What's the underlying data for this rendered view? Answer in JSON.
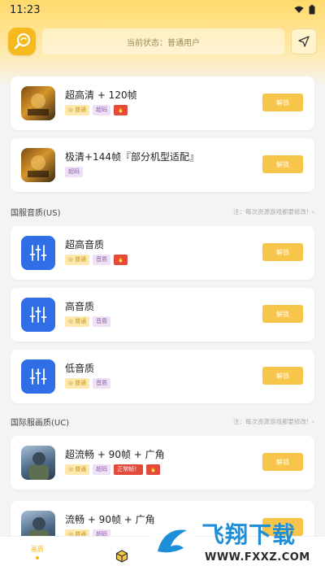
{
  "status_bar": {
    "time": "11:23"
  },
  "header": {
    "status_text": "当前状态：普通用户"
  },
  "colors": {
    "accent": "#f6c54a",
    "brand": "#f6b91e",
    "audio_icon": "#2f6ee6",
    "hot_tag": "#e24b3b"
  },
  "unlock_label": "解锁",
  "cards_top": [
    {
      "title": "超高清 + 120帧",
      "icon": "game-icon",
      "tags": [
        "普通",
        "超码",
        "hot"
      ]
    },
    {
      "title": "极清+144帧『部分机型适配』",
      "icon": "game-icon",
      "tags": [
        "超码"
      ]
    }
  ],
  "section_us": {
    "title": "国服音质(US)",
    "note": "注：每次资源游戏都要修改!"
  },
  "cards_us": [
    {
      "title": "超高音质",
      "icon": "equalizer-icon",
      "tags": [
        "普通",
        "音质",
        "hot"
      ]
    },
    {
      "title": "高音质",
      "icon": "equalizer-icon",
      "tags": [
        "普通",
        "音质"
      ]
    },
    {
      "title": "低音质",
      "icon": "equalizer-icon",
      "tags": [
        "普通",
        "音质"
      ]
    }
  ],
  "section_uc": {
    "title": "国际服画质(UC)",
    "note": "注：每次资源游戏都要修改!"
  },
  "cards_uc": [
    {
      "title": "超流畅 + 90帧 + 广角",
      "icon": "pubg-icon",
      "tags": [
        "普通",
        "超码",
        "正常帧！",
        "hot"
      ]
    },
    {
      "title": "流畅 + 90帧 + 广角",
      "icon": "pubg-icon",
      "tags": [
        "普通",
        "超码"
      ]
    }
  ],
  "bottom_nav": {
    "tab_quality": "画质"
  },
  "watermark": {
    "brand": "飞翔下载",
    "url": "WWW.FXXZ.COM"
  }
}
